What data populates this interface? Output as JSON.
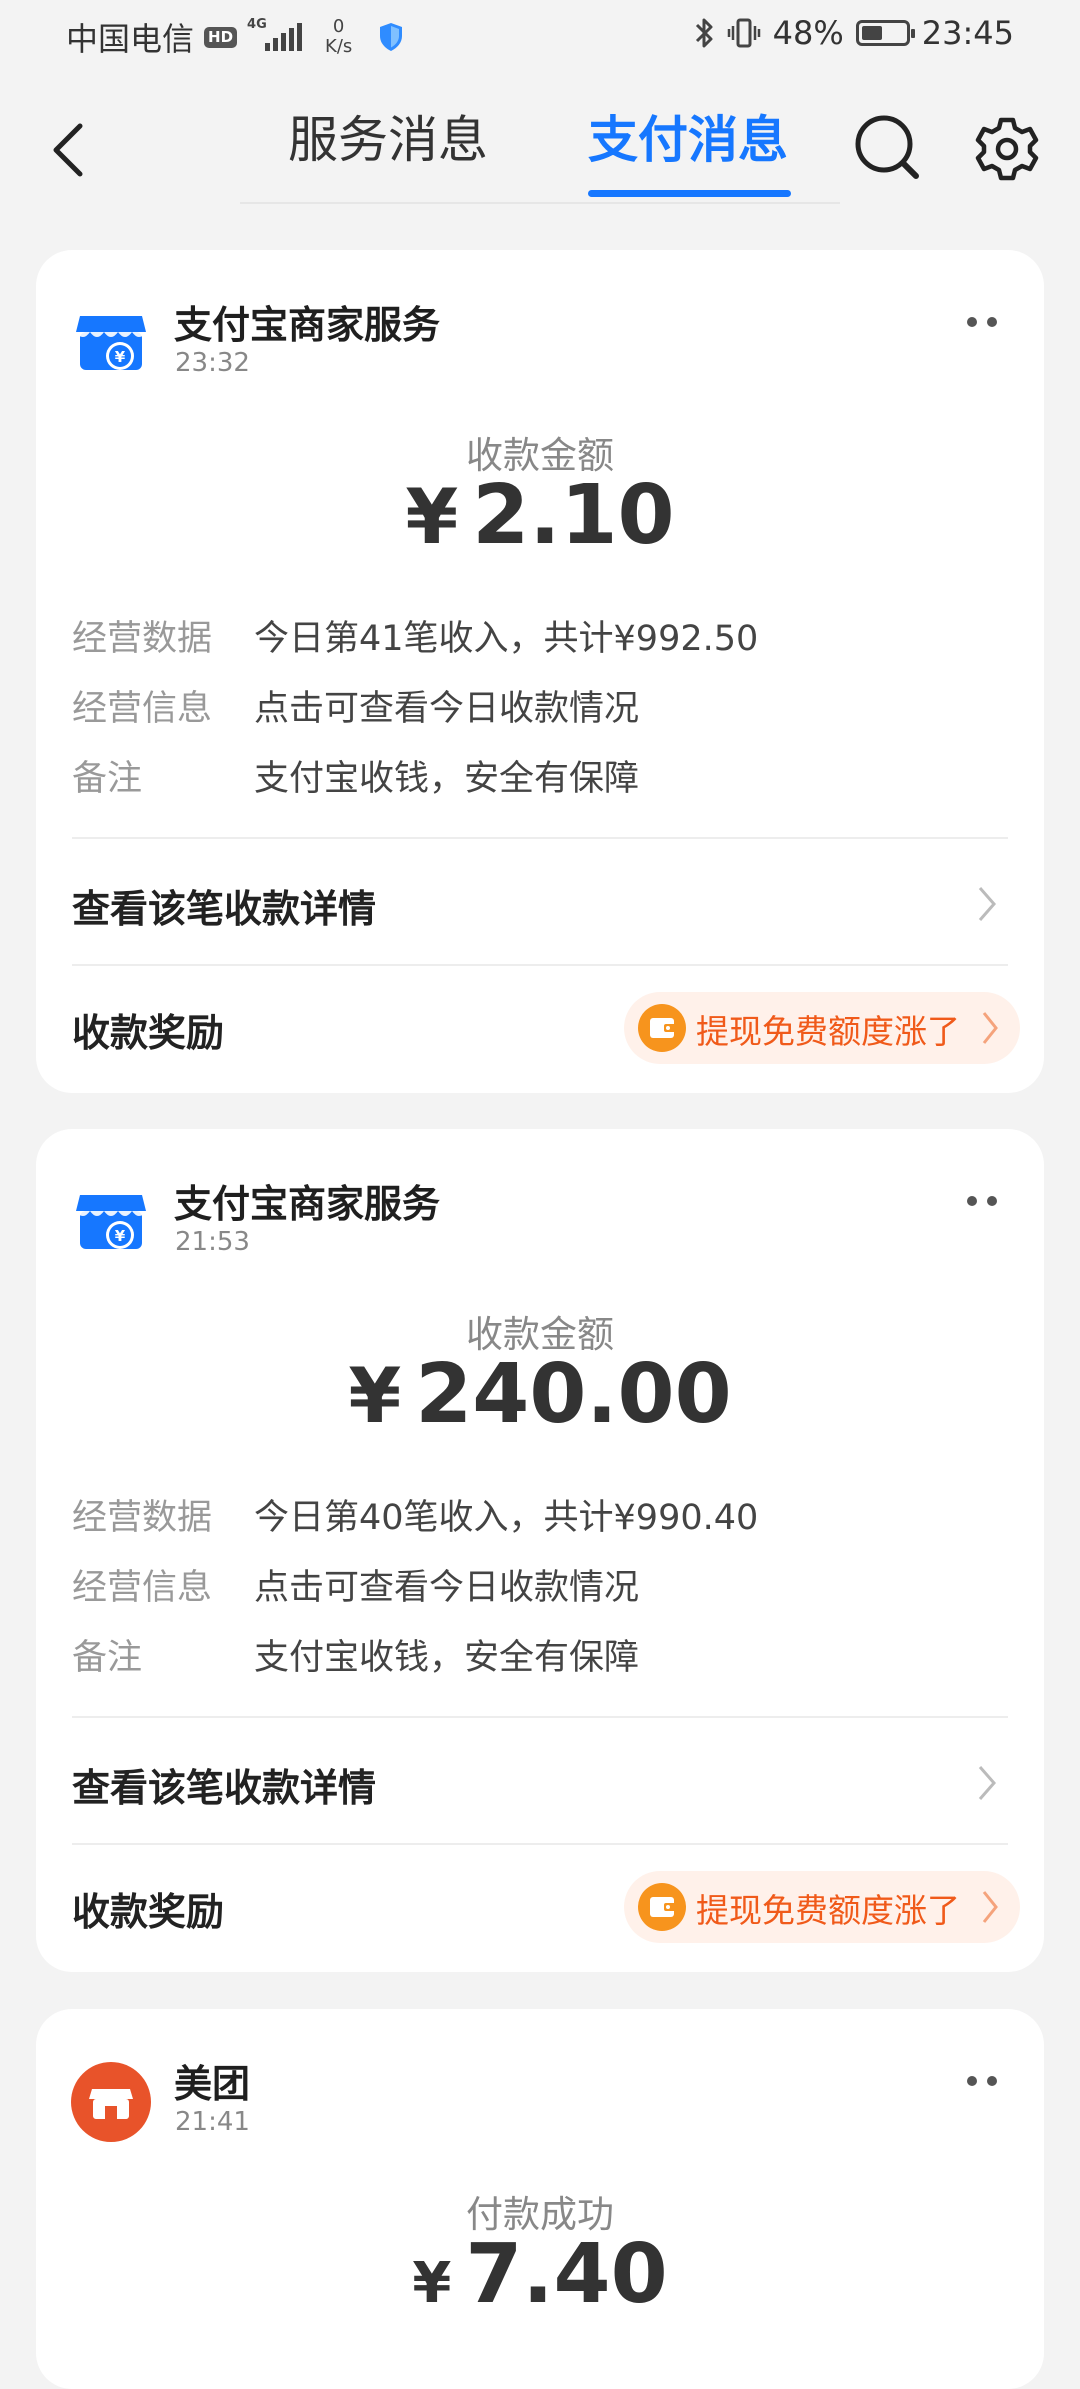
{
  "status_bar": {
    "carrier": "中国电信",
    "hd": "HD",
    "network": "4G",
    "net_speed_value": "0",
    "net_speed_unit": "K/s",
    "battery_percent": "48%",
    "battery_level": 0.48,
    "time": "23:45"
  },
  "header": {
    "tabs": [
      {
        "label": "服务消息",
        "active": false
      },
      {
        "label": "支付消息",
        "active": true
      }
    ]
  },
  "cards": [
    {
      "merchant": "支付宝商家服务",
      "time": "23:32",
      "amount_label": "收款金额",
      "currency": "¥",
      "amount": "2.10",
      "rows": [
        {
          "label": "经营数据",
          "value": "今日第41笔收入，共计¥992.50"
        },
        {
          "label": "经营信息",
          "value": "点击可查看今日收款情况"
        },
        {
          "label": "备注",
          "value": "支付宝收钱，安全有保障"
        }
      ],
      "detail_link": "查看该笔收款详情",
      "reward_label": "收款奖励",
      "reward_pill": "提现免费额度涨了"
    },
    {
      "merchant": "支付宝商家服务",
      "time": "21:53",
      "amount_label": "收款金额",
      "currency": "¥",
      "amount": "240.00",
      "rows": [
        {
          "label": "经营数据",
          "value": "今日第40笔收入，共计¥990.40"
        },
        {
          "label": "经营信息",
          "value": "点击可查看今日收款情况"
        },
        {
          "label": "备注",
          "value": "支付宝收钱，安全有保障"
        }
      ],
      "detail_link": "查看该笔收款详情",
      "reward_label": "收款奖励",
      "reward_pill": "提现免费额度涨了"
    },
    {
      "merchant": "美团",
      "time": "21:41",
      "amount_label": "付款成功",
      "currency": "¥",
      "amount": "7.40"
    }
  ],
  "colors": {
    "accent": "#1677ff",
    "reward_text": "#f05a1a",
    "meituan": "#e8532a",
    "alipay_store": "#1677ff"
  }
}
